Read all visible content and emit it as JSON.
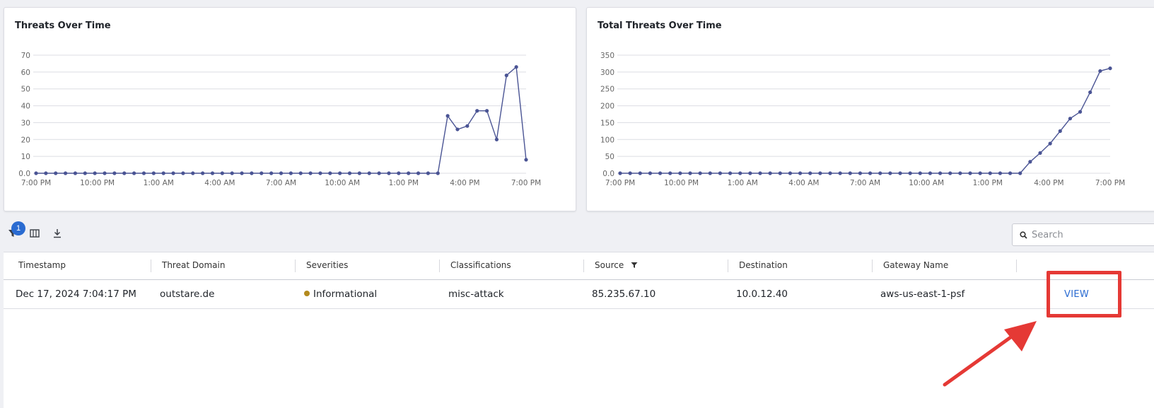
{
  "charts": {
    "threats_over_time": {
      "title": "Threats Over Time"
    },
    "total_threats_over_time": {
      "title": "Total Threats Over Time"
    }
  },
  "chart_data": [
    {
      "type": "line",
      "title": "Threats Over Time",
      "ylim": [
        0,
        70
      ],
      "yticks": [
        "0.0",
        "10",
        "20",
        "30",
        "40",
        "50",
        "60",
        "70"
      ],
      "ytick_values": [
        0,
        10,
        20,
        30,
        40,
        50,
        60,
        70
      ],
      "xtick_labels": [
        "7:00 PM",
        "10:00 PM",
        "1:00 AM",
        "4:00 AM",
        "7:00 AM",
        "10:00 AM",
        "1:00 PM",
        "4:00 PM",
        "7:00 PM"
      ],
      "grid": true,
      "color": "#4a5494",
      "values": [
        0,
        0,
        0,
        0,
        0,
        0,
        0,
        0,
        0,
        0,
        0,
        0,
        0,
        0,
        0,
        0,
        0,
        0,
        0,
        0,
        0,
        0,
        0,
        0,
        0,
        0,
        0,
        0,
        0,
        0,
        0,
        0,
        0,
        0,
        0,
        0,
        0,
        0,
        0,
        0,
        0,
        0,
        34,
        26,
        28,
        37,
        37,
        20,
        58,
        63,
        8
      ]
    },
    {
      "type": "line",
      "title": "Total Threats Over Time",
      "ylim": [
        0,
        350
      ],
      "yticks": [
        "0.0",
        "50",
        "100",
        "150",
        "200",
        "250",
        "300",
        "350"
      ],
      "ytick_values": [
        0,
        50,
        100,
        150,
        200,
        250,
        300,
        350
      ],
      "xtick_labels": [
        "7:00 PM",
        "10:00 PM",
        "1:00 AM",
        "4:00 AM",
        "7:00 AM",
        "10:00 AM",
        "1:00 PM",
        "4:00 PM",
        "7:00 PM"
      ],
      "grid": true,
      "color": "#4a5494",
      "values": [
        0,
        0,
        0,
        0,
        0,
        0,
        0,
        0,
        0,
        0,
        0,
        0,
        0,
        0,
        0,
        0,
        0,
        0,
        0,
        0,
        0,
        0,
        0,
        0,
        0,
        0,
        0,
        0,
        0,
        0,
        0,
        0,
        0,
        0,
        0,
        0,
        0,
        0,
        0,
        0,
        0,
        34,
        60,
        88,
        125,
        162,
        182,
        240,
        303,
        311
      ]
    }
  ],
  "toolbar": {
    "filter_count": "1",
    "search_placeholder": "Search"
  },
  "table": {
    "columns": [
      "Timestamp",
      "Threat Domain",
      "Severities",
      "Classifications",
      "Source",
      "Destination",
      "Gateway Name"
    ],
    "rows": [
      {
        "timestamp": "Dec 17, 2024 7:04:17 PM",
        "threat_domain": "outstare.de",
        "severity": "Informational",
        "severity_color": "#b38a1e",
        "classification": "misc-attack",
        "source": "85.235.67.10",
        "destination": "10.0.12.40",
        "gateway": "aws-us-east-1-psf",
        "action": "VIEW"
      }
    ]
  },
  "annotation": {
    "color": "#e53935"
  }
}
